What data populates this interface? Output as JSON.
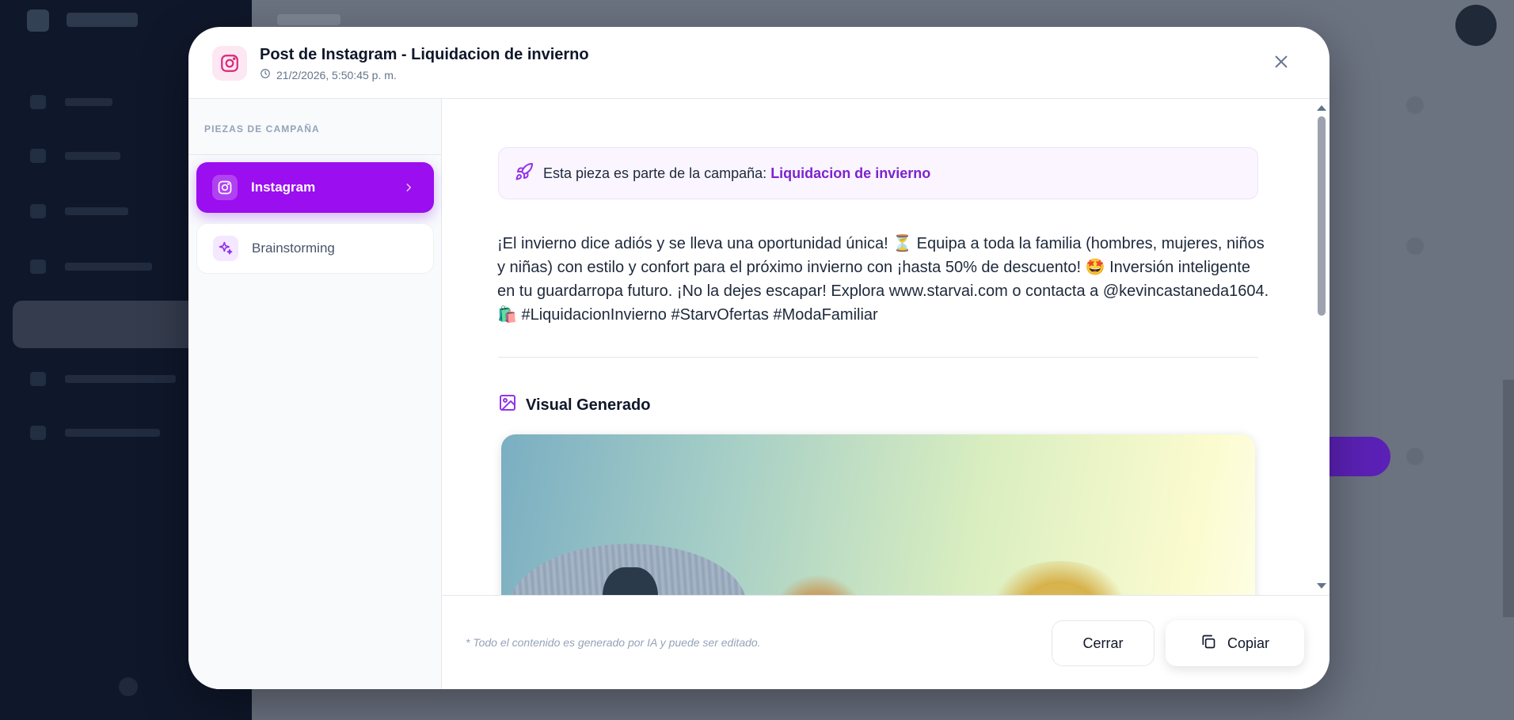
{
  "modal": {
    "title": "Post de Instagram - Liquidacion de invierno",
    "timestamp": "21/2/2026, 5:50:45 p. m.",
    "close_icon": "close-icon",
    "header_icon": "instagram-icon"
  },
  "sidebar": {
    "heading": "PIEZAS DE CAMPAÑA",
    "items": [
      {
        "label": "Instagram",
        "icon": "instagram-icon",
        "active": true
      },
      {
        "label": "Brainstorming",
        "icon": "sparkles-icon",
        "active": false
      }
    ]
  },
  "content": {
    "banner_prefix": "Esta pieza es parte de la campaña: ",
    "banner_campaign": "Liquidacion de invierno",
    "banner_icon": "rocket-icon",
    "post_text": "¡El invierno dice adiós y se lleva una oportunidad única! ⏳ Equipa a toda la familia (hombres, mujeres, niños\ny niñas) con estilo y confort para el próximo invierno con ¡hasta 50% de descuento! 🤩 Inversión inteligente\nen tu guardarropa futuro. ¡No la dejes escapar! Explora www.starvai.com o contacta a @kevincastaneda1604.\n🛍️ #LiquidacionInvierno #StarvOfertas #ModaFamiliar",
    "visual_heading": "Visual Generado",
    "visual_icon": "image-icon"
  },
  "footer": {
    "note": "* Todo el contenido es generado por IA y puede ser editado.",
    "close_label": "Cerrar",
    "copy_label": "Copiar",
    "copy_icon": "copy-icon"
  },
  "colors": {
    "accent": "#9b0eef",
    "campaign_link": "#7e22ce",
    "instagram_pink": "#db2777"
  }
}
